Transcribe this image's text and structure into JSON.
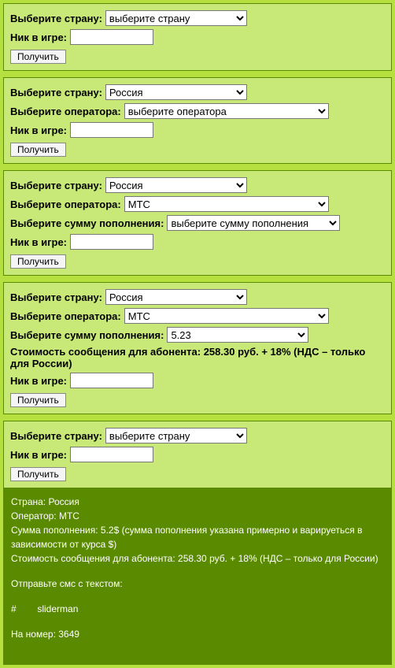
{
  "labels": {
    "country": "Выберите страну:",
    "operator": "Выберите оператора:",
    "amount": "Выберите сумму пополнения:",
    "nick": "Ник в игре:",
    "submit": "Получить",
    "cost_prefix": "Стоимость сообщения для абонента: 258.30 руб. + 18% (НДС – только для России)"
  },
  "options": {
    "country_placeholder": "выберите страну",
    "country_russia": "Россия",
    "operator_placeholder": "выберите оператора",
    "operator_mts": "МТС",
    "amount_placeholder": "выберите сумму пополнения",
    "amount_523": "5.23"
  },
  "result": {
    "l1": "Страна: Россия",
    "l2": "Оператор: МТС",
    "l3": "Сумма пополнения: 5.2$ (сумма пополнения указана примерно и варируеться в зависимости от курса $)",
    "l4": "Стоимость сообщения для абонента: 258.30 руб. + 18% (НДС – только для России)",
    "l5": "Отправьте смс с текстом:",
    "l6": "#        sliderman",
    "l7": "На номер: 3649"
  }
}
